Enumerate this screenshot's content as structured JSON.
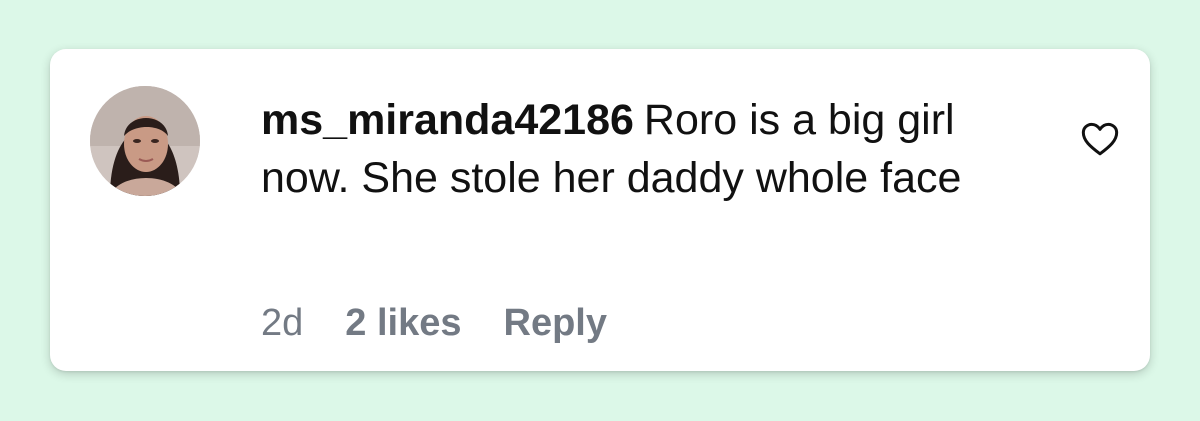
{
  "comment": {
    "username": "ms_miranda42186",
    "text": "Roro is a big girl now. She stole her daddy whole face",
    "time_ago": "2d",
    "likes_label": "2 likes",
    "reply_label": "Reply"
  },
  "icons": {
    "like": "heart-outline-icon",
    "avatar": "profile-photo"
  },
  "colors": {
    "background": "#dcf8e8",
    "card": "#ffffff",
    "text": "#111111",
    "meta": "#737a84"
  }
}
